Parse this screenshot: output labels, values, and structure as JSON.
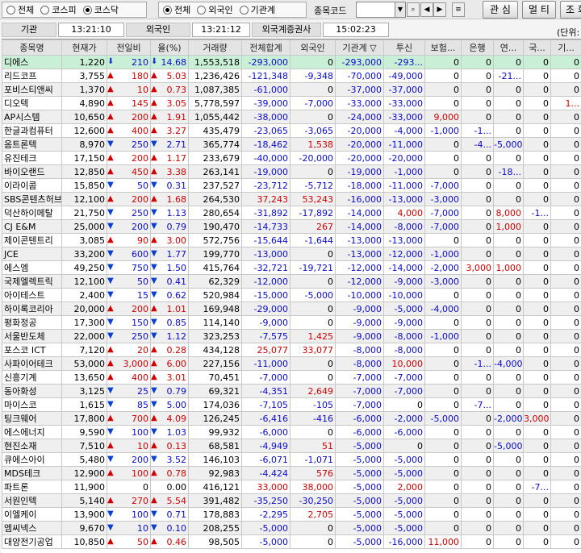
{
  "market_filter": {
    "options": [
      "전체",
      "코스피",
      "코스닥"
    ],
    "selected": 2
  },
  "investor_filter": {
    "options": [
      "전체",
      "외국인",
      "기관계"
    ],
    "selected": 0
  },
  "stock_code": {
    "label": "종목코드",
    "value": ""
  },
  "buttons": {
    "interest": "관 심",
    "multi": "멀 티",
    "inquiry": "조 회"
  },
  "timebar": {
    "inst_label": "기관",
    "inst_time": "13:21:10",
    "foreign_label": "외국인",
    "foreign_time": "13:21:12",
    "broker_label": "외국계증권사",
    "broker_time": "15:02:23",
    "unit": "(단위:"
  },
  "columns": [
    "종목명",
    "현재가",
    "전일비",
    "율(%)",
    "거래량",
    "전체합계",
    "외국인",
    "기관계 ▽",
    "투신",
    "보험...",
    "은행",
    "연...",
    "국...",
    "기..."
  ],
  "rows": [
    {
      "name": "디에스",
      "price": "1,220",
      "dir": "down",
      "chg": "210",
      "rate": "14.68",
      "vol": "1,553,518",
      "total": "-293,000",
      "foreign": "0",
      "inst": "-293,000",
      "trust": "-293...",
      "ins": "0",
      "bank": "0",
      "pen": "0",
      "nat": "0",
      "oth": "0"
    },
    {
      "name": "리드코프",
      "price": "3,755",
      "dir": "up",
      "chg": "180",
      "rate": "5.03",
      "vol": "1,236,426",
      "total": "-121,348",
      "foreign": "-9,348",
      "inst": "-70,000",
      "trust": "-49,000",
      "ins": "0",
      "bank": "0",
      "pen": "-21...",
      "nat": "0",
      "oth": "0"
    },
    {
      "name": "포비스티앤씨",
      "price": "1,370",
      "dir": "up",
      "chg": "10",
      "rate": "0.73",
      "vol": "1,087,385",
      "total": "-61,000",
      "foreign": "0",
      "inst": "-37,000",
      "trust": "-37,000",
      "ins": "0",
      "bank": "0",
      "pen": "0",
      "nat": "0",
      "oth": "0"
    },
    {
      "name": "디오텍",
      "price": "4,890",
      "dir": "up",
      "chg": "145",
      "rate": "3.05",
      "vol": "5,778,597",
      "total": "-39,000",
      "foreign": "-7,000",
      "inst": "-33,000",
      "trust": "-33,000",
      "ins": "0",
      "bank": "0",
      "pen": "0",
      "nat": "0",
      "oth": "1..."
    },
    {
      "name": "AP시스템",
      "price": "10,650",
      "dir": "up",
      "chg": "200",
      "rate": "1.91",
      "vol": "1,055,442",
      "total": "-38,000",
      "foreign": "0",
      "inst": "-24,000",
      "trust": "-33,000",
      "ins": "9,000",
      "bank": "0",
      "pen": "0",
      "nat": "0",
      "oth": "0"
    },
    {
      "name": "한글과컴퓨터",
      "price": "12,600",
      "dir": "up",
      "chg": "400",
      "rate": "3.27",
      "vol": "435,479",
      "total": "-23,065",
      "foreign": "-3,065",
      "inst": "-20,000",
      "trust": "-4,000",
      "ins": "-1,000",
      "bank": "-1...",
      "pen": "0",
      "nat": "0",
      "oth": "0"
    },
    {
      "name": "옴트론텍",
      "price": "8,970",
      "dir": "down",
      "chg": "250",
      "rate": "2.71",
      "vol": "365,774",
      "total": "-18,462",
      "foreign": "1,538",
      "inst": "-20,000",
      "trust": "-11,000",
      "ins": "0",
      "bank": "-4...",
      "pen": "-5,000",
      "nat": "0",
      "oth": "0"
    },
    {
      "name": "유진테크",
      "price": "17,150",
      "dir": "up",
      "chg": "200",
      "rate": "1.17",
      "vol": "233,679",
      "total": "-40,000",
      "foreign": "-20,000",
      "inst": "-20,000",
      "trust": "-20,000",
      "ins": "0",
      "bank": "0",
      "pen": "0",
      "nat": "0",
      "oth": "0"
    },
    {
      "name": "바이오랜드",
      "price": "12,850",
      "dir": "up",
      "chg": "450",
      "rate": "3.38",
      "vol": "263,141",
      "total": "-19,000",
      "foreign": "0",
      "inst": "-19,000",
      "trust": "-1,000",
      "ins": "0",
      "bank": "0",
      "pen": "-18...",
      "nat": "0",
      "oth": "0"
    },
    {
      "name": "이라이콤",
      "price": "15,850",
      "dir": "down",
      "chg": "50",
      "rate": "0.31",
      "vol": "237,527",
      "total": "-23,712",
      "foreign": "-5,712",
      "inst": "-18,000",
      "trust": "-11,000",
      "ins": "-7,000",
      "bank": "0",
      "pen": "0",
      "nat": "0",
      "oth": "0"
    },
    {
      "name": "SBS콘텐츠허브",
      "price": "12,100",
      "dir": "up",
      "chg": "200",
      "rate": "1.68",
      "vol": "264,530",
      "total": "37,243",
      "foreign": "53,243",
      "inst": "-16,000",
      "trust": "-13,000",
      "ins": "-3,000",
      "bank": "0",
      "pen": "0",
      "nat": "0",
      "oth": "0"
    },
    {
      "name": "덕산하이메탈",
      "price": "21,750",
      "dir": "down",
      "chg": "250",
      "rate": "1.13",
      "vol": "280,654",
      "total": "-31,892",
      "foreign": "-17,892",
      "inst": "-14,000",
      "trust": "4,000",
      "ins": "-7,000",
      "bank": "0",
      "pen": "8,000",
      "nat": "-1...",
      "oth": "0"
    },
    {
      "name": "CJ E&M",
      "price": "25,000",
      "dir": "down",
      "chg": "200",
      "rate": "0.79",
      "vol": "190,470",
      "total": "-14,733",
      "foreign": "267",
      "inst": "-14,000",
      "trust": "-8,000",
      "ins": "-7,000",
      "bank": "0",
      "pen": "1,000",
      "nat": "0",
      "oth": "0"
    },
    {
      "name": "제이콘텐트리",
      "price": "3,085",
      "dir": "up",
      "chg": "90",
      "rate": "3.00",
      "vol": "572,756",
      "total": "-15,644",
      "foreign": "-1,644",
      "inst": "-13,000",
      "trust": "-13,000",
      "ins": "0",
      "bank": "0",
      "pen": "0",
      "nat": "0",
      "oth": "0"
    },
    {
      "name": "JCE",
      "price": "33,200",
      "dir": "down",
      "chg": "600",
      "rate": "1.77",
      "vol": "199,770",
      "total": "-13,000",
      "foreign": "0",
      "inst": "-13,000",
      "trust": "-12,000",
      "ins": "-1,000",
      "bank": "0",
      "pen": "0",
      "nat": "0",
      "oth": "0"
    },
    {
      "name": "에스엠",
      "price": "49,250",
      "dir": "down",
      "chg": "750",
      "rate": "1.50",
      "vol": "415,764",
      "total": "-32,721",
      "foreign": "-19,721",
      "inst": "-12,000",
      "trust": "-14,000",
      "ins": "-2,000",
      "bank": "3,000",
      "pen": "1,000",
      "nat": "0",
      "oth": "0"
    },
    {
      "name": "국제엘렉트릭",
      "price": "12,100",
      "dir": "down",
      "chg": "50",
      "rate": "0.41",
      "vol": "62,329",
      "total": "-12,000",
      "foreign": "0",
      "inst": "-12,000",
      "trust": "-9,000",
      "ins": "-3,000",
      "bank": "0",
      "pen": "0",
      "nat": "0",
      "oth": "0"
    },
    {
      "name": "아이테스트",
      "price": "2,400",
      "dir": "down",
      "chg": "15",
      "rate": "0.62",
      "vol": "520,984",
      "total": "-15,000",
      "foreign": "-5,000",
      "inst": "-10,000",
      "trust": "-10,000",
      "ins": "0",
      "bank": "0",
      "pen": "0",
      "nat": "0",
      "oth": "0"
    },
    {
      "name": "하이록코리아",
      "price": "20,000",
      "dir": "up",
      "chg": "200",
      "rate": "1.01",
      "vol": "169,948",
      "total": "-29,000",
      "foreign": "0",
      "inst": "-9,000",
      "trust": "-5,000",
      "ins": "-4,000",
      "bank": "0",
      "pen": "0",
      "nat": "0",
      "oth": "0"
    },
    {
      "name": "평화정공",
      "price": "17,300",
      "dir": "down",
      "chg": "150",
      "rate": "0.85",
      "vol": "114,140",
      "total": "-9,000",
      "foreign": "0",
      "inst": "-9,000",
      "trust": "-9,000",
      "ins": "0",
      "bank": "0",
      "pen": "0",
      "nat": "0",
      "oth": "0"
    },
    {
      "name": "서울반도체",
      "price": "22,000",
      "dir": "down",
      "chg": "250",
      "rate": "1.12",
      "vol": "323,253",
      "total": "-7,575",
      "foreign": "1,425",
      "inst": "-9,000",
      "trust": "-8,000",
      "ins": "-1,000",
      "bank": "0",
      "pen": "0",
      "nat": "0",
      "oth": "0"
    },
    {
      "name": "포스코 ICT",
      "price": "7,120",
      "dir": "up",
      "chg": "20",
      "rate": "0.28",
      "vol": "434,128",
      "total": "25,077",
      "foreign": "33,077",
      "inst": "-8,000",
      "trust": "-8,000",
      "ins": "0",
      "bank": "0",
      "pen": "0",
      "nat": "0",
      "oth": "0"
    },
    {
      "name": "사파이어테크",
      "price": "53,000",
      "dir": "up",
      "chg": "3,000",
      "rate": "6.00",
      "vol": "227,156",
      "total": "-11,000",
      "foreign": "0",
      "inst": "-8,000",
      "trust": "10,000",
      "ins": "0",
      "bank": "-1...",
      "pen": "-4,000",
      "nat": "0",
      "oth": "0"
    },
    {
      "name": "신흥기계",
      "price": "13,650",
      "dir": "up",
      "chg": "400",
      "rate": "3.01",
      "vol": "70,451",
      "total": "-7,000",
      "foreign": "0",
      "inst": "-7,000",
      "trust": "-7,000",
      "ins": "0",
      "bank": "0",
      "pen": "0",
      "nat": "0",
      "oth": "0"
    },
    {
      "name": "동아화성",
      "price": "3,125",
      "dir": "down",
      "chg": "25",
      "rate": "0.79",
      "vol": "69,321",
      "total": "-4,351",
      "foreign": "2,649",
      "inst": "-7,000",
      "trust": "-7,000",
      "ins": "0",
      "bank": "0",
      "pen": "0",
      "nat": "0",
      "oth": "0"
    },
    {
      "name": "마이스코",
      "price": "1,615",
      "dir": "down",
      "chg": "85",
      "rate": "5.00",
      "vol": "174,036",
      "total": "-7,105",
      "foreign": "-105",
      "inst": "-7,000",
      "trust": "0",
      "ins": "0",
      "bank": "-7...",
      "pen": "0",
      "nat": "0",
      "oth": "0"
    },
    {
      "name": "팅크웨어",
      "price": "17,800",
      "dir": "up",
      "chg": "700",
      "rate": "4.09",
      "vol": "126,245",
      "total": "-6,416",
      "foreign": "-416",
      "inst": "-6,000",
      "trust": "-2,000",
      "ins": "-5,000",
      "bank": "0",
      "pen": "-2,000",
      "nat": "3,000",
      "oth": "0"
    },
    {
      "name": "에스에너지",
      "price": "9,590",
      "dir": "down",
      "chg": "100",
      "rate": "1.03",
      "vol": "99,932",
      "total": "-6,000",
      "foreign": "0",
      "inst": "-6,000",
      "trust": "-6,000",
      "ins": "0",
      "bank": "0",
      "pen": "0",
      "nat": "0",
      "oth": "0"
    },
    {
      "name": "현진소재",
      "price": "7,510",
      "dir": "up",
      "chg": "10",
      "rate": "0.13",
      "vol": "68,581",
      "total": "-4,949",
      "foreign": "51",
      "inst": "-5,000",
      "trust": "0",
      "ins": "0",
      "bank": "0",
      "pen": "-5,000",
      "nat": "0",
      "oth": "0"
    },
    {
      "name": "큐에스아이",
      "price": "5,480",
      "dir": "down",
      "chg": "200",
      "rate": "3.52",
      "vol": "146,103",
      "total": "-6,071",
      "foreign": "-1,071",
      "inst": "-5,000",
      "trust": "-5,000",
      "ins": "0",
      "bank": "0",
      "pen": "0",
      "nat": "0",
      "oth": "0"
    },
    {
      "name": "MDS테크",
      "price": "12,900",
      "dir": "up",
      "chg": "100",
      "rate": "0.78",
      "vol": "92,983",
      "total": "-4,424",
      "foreign": "576",
      "inst": "-5,000",
      "trust": "-5,000",
      "ins": "0",
      "bank": "0",
      "pen": "0",
      "nat": "0",
      "oth": "0"
    },
    {
      "name": "파트론",
      "price": "11,900",
      "dir": "flat",
      "chg": "0",
      "rate": "0.00",
      "vol": "416,121",
      "total": "33,000",
      "foreign": "38,000",
      "inst": "-5,000",
      "trust": "2,000",
      "ins": "0",
      "bank": "0",
      "pen": "0",
      "nat": "-7...",
      "oth": "0"
    },
    {
      "name": "서원인텍",
      "price": "5,140",
      "dir": "up",
      "chg": "270",
      "rate": "5.54",
      "vol": "391,482",
      "total": "-35,250",
      "foreign": "-30,250",
      "inst": "-5,000",
      "trust": "-5,000",
      "ins": "0",
      "bank": "0",
      "pen": "0",
      "nat": "0",
      "oth": "0"
    },
    {
      "name": "이엘케이",
      "price": "13,900",
      "dir": "down",
      "chg": "100",
      "rate": "0.71",
      "vol": "178,883",
      "total": "-2,295",
      "foreign": "2,705",
      "inst": "-5,000",
      "trust": "-5,000",
      "ins": "0",
      "bank": "0",
      "pen": "0",
      "nat": "0",
      "oth": "0"
    },
    {
      "name": "엠씨넥스",
      "price": "9,670",
      "dir": "down",
      "chg": "10",
      "rate": "0.10",
      "vol": "208,255",
      "total": "-5,000",
      "foreign": "0",
      "inst": "-5,000",
      "trust": "-5,000",
      "ins": "0",
      "bank": "0",
      "pen": "0",
      "nat": "0",
      "oth": "0"
    },
    {
      "name": "대양전기공업",
      "price": "10,850",
      "dir": "up",
      "chg": "50",
      "rate": "0.46",
      "vol": "98,505",
      "total": "-5,000",
      "foreign": "0",
      "inst": "-5,000",
      "trust": "-16,000",
      "ins": "11,000",
      "bank": "0",
      "pen": "0",
      "nat": "0",
      "oth": "0"
    }
  ],
  "colors": {
    "up": "#d10000",
    "down": "#0a3fcf",
    "selected_row": "#c9f0d6"
  }
}
